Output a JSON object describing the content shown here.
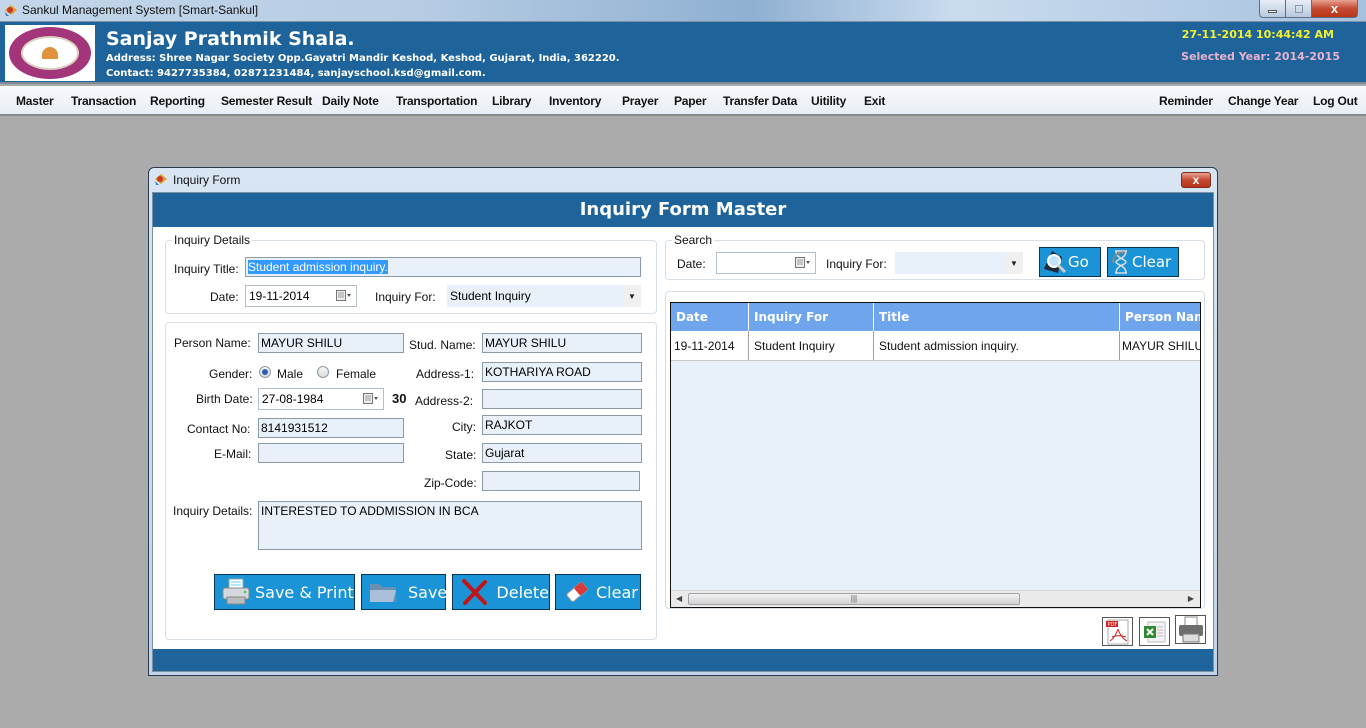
{
  "os_window": {
    "title": "Sankul Management System [Smart-Sankul]",
    "app_icon": "app-logo-icon",
    "controls": {
      "minimize": "minimize-icon",
      "maximize": "restore-icon",
      "close": "close-icon",
      "close_glyph": "x"
    }
  },
  "header": {
    "school_name": "Sanjay Prathmik Shala.",
    "address": "Address: Shree Nagar Society  Opp.Gayatri Mandir Keshod, Keshod, Gujarat, India, 362220.",
    "contact": "Contact: 9427735384, 02871231484, sanjayschool.ksd@gmail.com.",
    "datetime": "27-11-2014 10:44:42 AM",
    "selected_year": "Selected Year: 2014-2015",
    "colors": {
      "header_bg": "#1e6399",
      "datetime": "#f4f22c",
      "selected_year": "#e7b2cf"
    }
  },
  "menu": {
    "left": [
      "Master",
      "Transaction",
      "Reporting",
      "Semester Result",
      "Daily Note",
      "Transportation",
      "Library",
      "Inventory",
      "Prayer",
      "Paper",
      "Transfer Data",
      "Uitility",
      "Exit"
    ],
    "right": [
      "Reminder",
      "Change Year",
      "Log Out"
    ]
  },
  "child_window": {
    "title": "Inquiry Form",
    "close_glyph": "x",
    "header": "Inquiry Form Master"
  },
  "inquiry_details": {
    "legend": "Inquiry Details",
    "title_label": "Inquiry Title:",
    "title_value": "Student admission inquiry.",
    "date_label": "Date:",
    "date_value": "19-11-2014",
    "inquiry_for_label": "Inquiry For:",
    "inquiry_for_value": "Student Inquiry"
  },
  "person": {
    "person_name_label": "Person Name:",
    "person_name_value": "MAYUR SHILU",
    "stud_name_label": "Stud. Name:",
    "stud_name_value": "MAYUR SHILU",
    "gender_label": "Gender:",
    "gender_options": [
      "Male",
      "Female"
    ],
    "gender_selected": "Male",
    "address1_label": "Address-1:",
    "address1_value": "KOTHARIYA ROAD",
    "birth_date_label": "Birth Date:",
    "birth_date_value": "27-08-1984",
    "age_value": "30",
    "address2_label": "Address-2:",
    "address2_value": "",
    "contact_label": "Contact No:",
    "contact_value": "8141931512",
    "city_label": "City:",
    "city_value": "RAJKOT",
    "email_label": "E-Mail:",
    "email_value": "",
    "state_label": "State:",
    "state_value": "Gujarat",
    "zip_label": "Zip-Code:",
    "zip_value": "",
    "details_label": "Inquiry Details:",
    "details_value": "INTERESTED TO ADDMISSION IN BCA"
  },
  "actions": {
    "save_print": "Save & Print",
    "save": "Save",
    "delete": "Delete",
    "clear": "Clear",
    "icons": [
      "printer-icon",
      "folder-icon",
      "delete-x-icon",
      "eraser-icon"
    ],
    "button_color": "#1a94d6"
  },
  "search": {
    "legend": "Search",
    "date_label": "Date:",
    "date_value": "",
    "inquiry_for_label": "Inquiry For:",
    "inquiry_for_value": "",
    "go_label": "Go",
    "clear_label": "Clear"
  },
  "grid": {
    "columns": [
      "Date",
      "Inquiry For",
      "Title",
      "Person Name"
    ],
    "rows": [
      [
        "19-11-2014",
        "Student Inquiry",
        "Student admission inquiry.",
        "MAYUR SHILU"
      ]
    ],
    "header_color": "#6fa5ed"
  },
  "export": {
    "pdf": "pdf-icon",
    "excel": "excel-icon",
    "print": "printer-icon",
    "pdf_badge": "PDF"
  }
}
